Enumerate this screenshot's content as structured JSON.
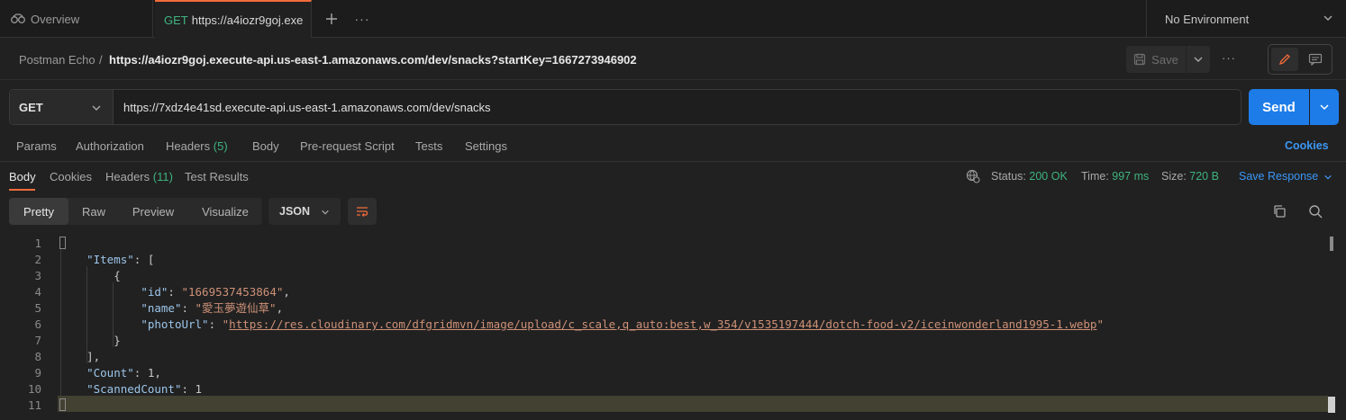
{
  "tabs": {
    "overview_label": "Overview",
    "active_method": "GET",
    "active_label": "https://a4iozr9goj.exe",
    "more": "···"
  },
  "environment": {
    "label": "No Environment"
  },
  "breadcrumb": {
    "collection": "Postman Echo",
    "separator": "/",
    "request_name": "https://a4iozr9goj.execute-api.us-east-1.amazonaws.com/dev/snacks?startKey=1667273946902"
  },
  "toolbar": {
    "save_label": "Save",
    "more": "···"
  },
  "request": {
    "method": "GET",
    "url": "https://7xdz4e41sd.execute-api.us-east-1.amazonaws.com/dev/snacks",
    "send_label": "Send"
  },
  "request_tabs": {
    "params": "Params",
    "authorization": "Authorization",
    "headers": "Headers",
    "headers_count": "(5)",
    "body": "Body",
    "prerequest": "Pre-request Script",
    "tests": "Tests",
    "settings": "Settings",
    "cookies": "Cookies"
  },
  "response_tabs": {
    "body": "Body",
    "cookies": "Cookies",
    "headers": "Headers",
    "headers_count": "(11)",
    "test_results": "Test Results"
  },
  "response_status": {
    "status_label": "Status:",
    "status_value": "200 OK",
    "time_label": "Time:",
    "time_value": "997 ms",
    "size_label": "Size:",
    "size_value": "720 B",
    "save_response": "Save Response"
  },
  "view_modes": {
    "pretty": "Pretty",
    "raw": "Raw",
    "preview": "Preview",
    "visualize": "Visualize",
    "format": "JSON"
  },
  "code": {
    "line_numbers": [
      "1",
      "2",
      "3",
      "4",
      "5",
      "6",
      "7",
      "8",
      "9",
      "10",
      "11"
    ],
    "lines": {
      "l1": "{",
      "l2_key": "\"Items\"",
      "l2_rest": ": [",
      "l3": "{",
      "l4_key": "\"id\"",
      "l4_val": "\"1669537453864\"",
      "l5_key": "\"name\"",
      "l5_val": "\"愛玉夢遊仙草\"",
      "l6_key": "\"photoUrl\"",
      "l6_q": "\"",
      "l6_url": "https://res.cloudinary.com/dfgridmvn/image/upload/c_scale,q_auto:best,w_354/v1535197444/dotch-food-v2/iceinwonderland1995-1.webp",
      "l7": "}",
      "l8": "],",
      "l9_key": "\"Count\"",
      "l9_val": "1",
      "l10_key": "\"ScannedCount\"",
      "l10_val": "1",
      "l11": "}"
    }
  }
}
